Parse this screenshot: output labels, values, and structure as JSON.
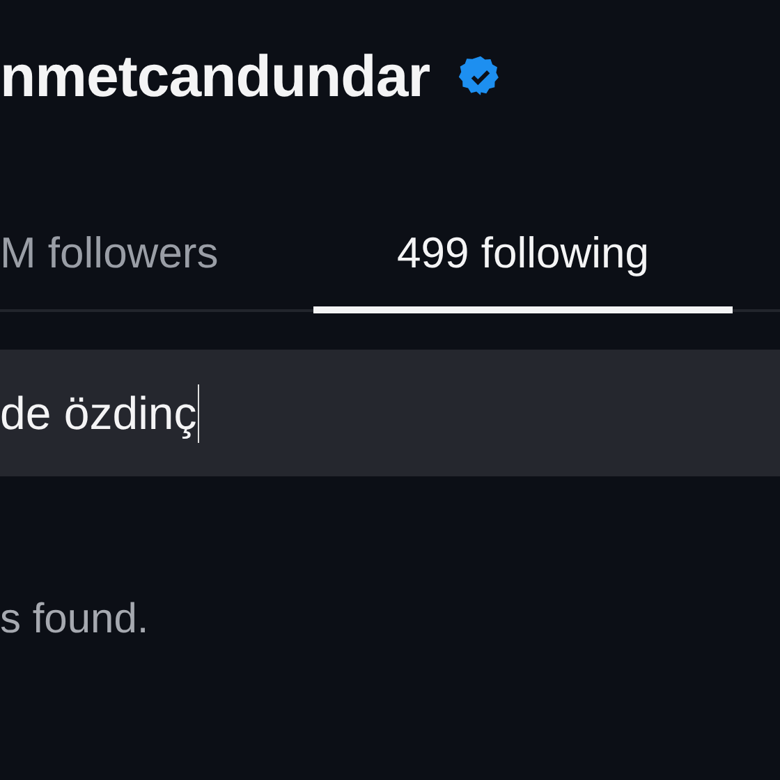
{
  "profile": {
    "username": "nmetcandundar",
    "verified": true
  },
  "tabs": [
    {
      "label": "M followers",
      "selected": false
    },
    {
      "label": "499 following",
      "selected": true
    }
  ],
  "search": {
    "value": "de özdinç"
  },
  "message": "s found."
}
